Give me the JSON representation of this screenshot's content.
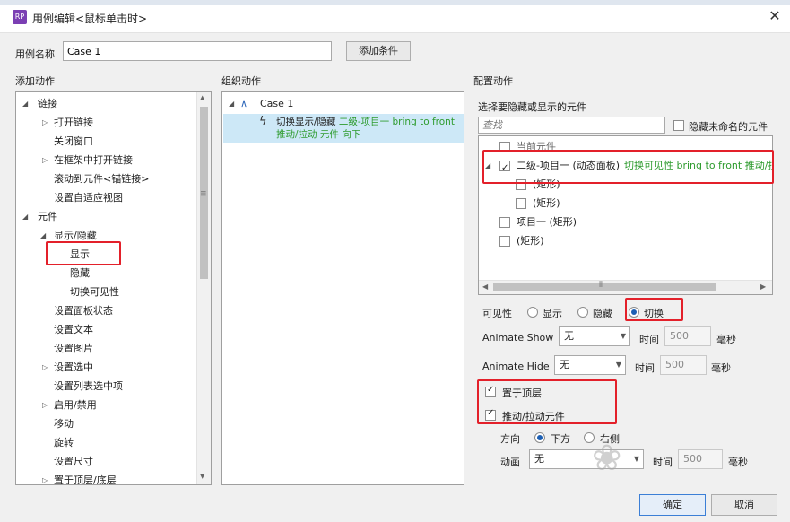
{
  "window": {
    "title": "用例编辑<鼠标单击时>",
    "app_badge": "RP"
  },
  "case_name": {
    "label": "用例名称",
    "value": "Case 1",
    "add_condition": "添加条件"
  },
  "headers": {
    "add_action": "添加动作",
    "organize_action": "组织动作",
    "configure_action": "配置动作"
  },
  "add_tree": {
    "links": "链接",
    "open_link": "打开链接",
    "close_window": "关闭窗口",
    "open_in_frame": "在框架中打开链接",
    "scroll_to": "滚动到元件<锚链接>",
    "adaptive_view": "设置自适应视图",
    "widgets": "元件",
    "show_hide": "显示/隐藏",
    "show": "显示",
    "hide": "隐藏",
    "toggle_visibility": "切换可见性",
    "panel_state": "设置面板状态",
    "set_text": "设置文本",
    "set_image": "设置图片",
    "set_selected": "设置选中",
    "list_selected": "设置列表选中项",
    "enable_disable": "启用/禁用",
    "move": "移动",
    "rotate": "旋转",
    "set_size": "设置尺寸",
    "bring_front_back": "置于顶层/底层"
  },
  "organize": {
    "case": "Case 1",
    "action_name": "切换显示/隐藏",
    "action_detail_1": "二级-项目一 bring to front",
    "action_detail_2": "推动/拉动 元件 向下"
  },
  "configure": {
    "select_label": "选择要隐藏或显示的元件",
    "search_placeholder": "查找",
    "hide_unnamed": "隐藏未命名的元件",
    "current_widget": "当前元件",
    "item_panel": "二级-项目一 (动态面板)",
    "item_panel_detail": "切换可见性 bring to front 推动/拉动",
    "rect_1": "(矩形)",
    "rect_2": "(矩形)",
    "item_one": "项目一 (矩形)",
    "rect_3": "(矩形)",
    "visibility_label": "可见性",
    "vis_show": "显示",
    "vis_hide": "隐藏",
    "vis_toggle": "切换",
    "animate_show": "Animate Show",
    "animate_show_value": "无",
    "time_label_1": "时间",
    "time_show": "500",
    "ms_1": "毫秒",
    "animate_hide": "Animate Hide",
    "animate_hide_value": "无",
    "time_label_2": "时间",
    "time_hide": "500",
    "ms_2": "毫秒",
    "bring_to_top": "置于顶层",
    "push_pull": "推动/拉动元件",
    "direction_label": "方向",
    "dir_below": "下方",
    "dir_right": "右侧",
    "animation_label": "动画",
    "animation_value": "无",
    "time_label_3": "时间",
    "time_anim": "500",
    "ms_3": "毫秒"
  },
  "buttons": {
    "ok": "确定",
    "cancel": "取消"
  },
  "colors": {
    "accent_red": "#e3202a",
    "selected_row": "#cde8f7",
    "green_text": "#2e9b2e"
  }
}
